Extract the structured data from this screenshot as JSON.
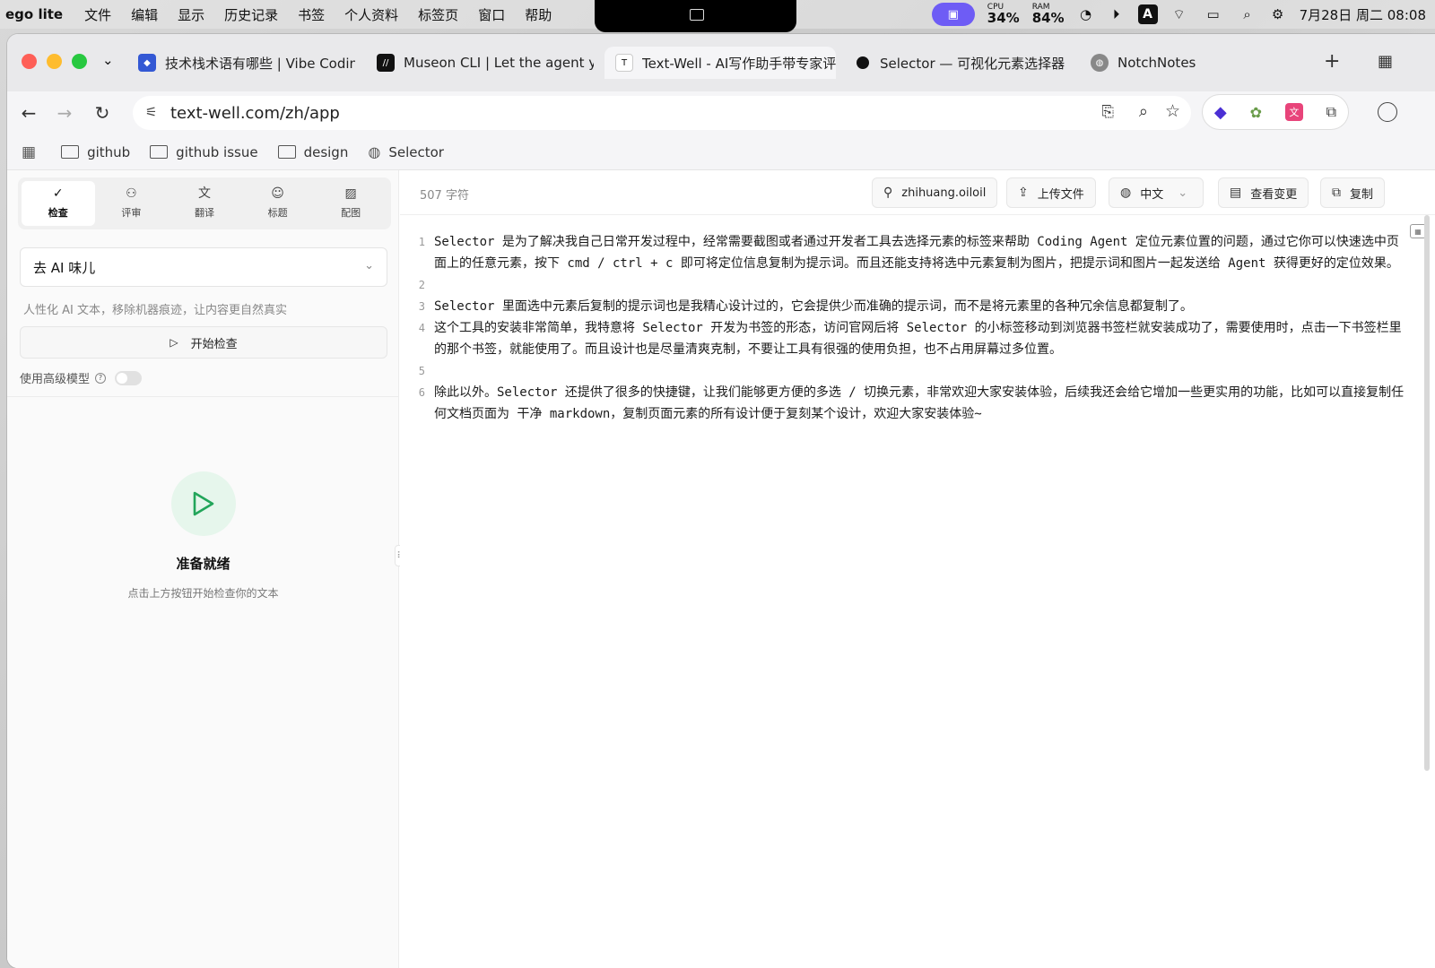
{
  "menubar": {
    "app_name": "ego lite",
    "items": [
      "文件",
      "编辑",
      "显示",
      "历史记录",
      "书签",
      "个人资料",
      "标签页",
      "窗口",
      "帮助"
    ],
    "cpu_label": "CPU",
    "cpu_value": "34%",
    "ram_label": "RAM",
    "ram_value": "84%",
    "input_method": "A",
    "datetime": "7月28日 周二 08:08"
  },
  "tabs": [
    {
      "title": "技术栈术语有哪些 | Vibe Coding",
      "favicon": "blue-logo"
    },
    {
      "title": "Museon CLI | Let the agent you",
      "favicon": "black-logo"
    },
    {
      "title": "Text-Well - AI写作助手带专家评",
      "favicon": "tw-logo",
      "active": true
    },
    {
      "title": "Selector — 可视化元素选择器",
      "favicon": "black-dot"
    },
    {
      "title": "NotchNotes",
      "favicon": "globe-icon"
    }
  ],
  "address": {
    "url": "text-well.com/zh/app"
  },
  "bookmarks": [
    "github",
    "github issue",
    "design",
    "Selector"
  ],
  "sidebar": {
    "tools": [
      {
        "label": "检查",
        "icon": "check-text-icon",
        "active": true
      },
      {
        "label": "评审",
        "icon": "users-icon"
      },
      {
        "label": "翻译",
        "icon": "translate-icon"
      },
      {
        "label": "标题",
        "icon": "emoji-icon"
      },
      {
        "label": "配图",
        "icon": "image-icon"
      }
    ],
    "mode_select": "去 AI 味儿",
    "mode_description": "人性化 AI 文本，移除机器痕迹，让内容更自然真实",
    "start_button": "开始检查",
    "advanced_model_label": "使用高级模型",
    "ready_title": "准备就绪",
    "ready_hint": "点击上方按钮开始检查你的文本"
  },
  "editor": {
    "char_count": "507 字符",
    "user": "zhihuang.oiloil",
    "upload_label": "上传文件",
    "language": "中文",
    "view_changes_label": "查看变更",
    "copy_label": "复制",
    "lines": [
      {
        "no": "1",
        "text": "Selector 是为了解决我自己日常开发过程中，经常需要截图或者通过开发者工具去选择元素的标签来帮助 Coding Agent 定位元素位置的问题，通过它你可以快速选中页面上的任意元素，按下 cmd / ctrl + c 即可将定位信息复制为提示词。而且还能支持将选中元素复制为图片，把提示词和图片一起发送给 Agent 获得更好的定位效果。"
      },
      {
        "no": "2",
        "text": ""
      },
      {
        "no": "3",
        "text": "Selector 里面选中元素后复制的提示词也是我精心设计过的，它会提供少而准确的提示词，而不是将元素里的各种冗余信息都复制了。"
      },
      {
        "no": "4",
        "text": "这个工具的安装非常简单，我特意将 Selector 开发为书签的形态，访问官网后将 Selector 的小标签移动到浏览器书签栏就安装成功了，需要使用时，点击一下书签栏里的那个书签，就能使用了。而且设计也是尽量清爽克制，不要让工具有很强的使用负担，也不占用屏幕过多位置。"
      },
      {
        "no": "5",
        "text": ""
      },
      {
        "no": "6",
        "text": "除此以外。Selector 还提供了很多的快捷键，让我们能够更方便的多选 / 切换元素，非常欢迎大家安装体验，后续我还会给它增加一些更实用的功能，比如可以直接复制任何文档页面为 干净 markdown，复制页面元素的所有设计便于复刻某个设计，欢迎大家安装体验~"
      }
    ]
  },
  "colors": {
    "accent_green": "#22a55a",
    "menubar_pill": "#6e5cf5"
  }
}
